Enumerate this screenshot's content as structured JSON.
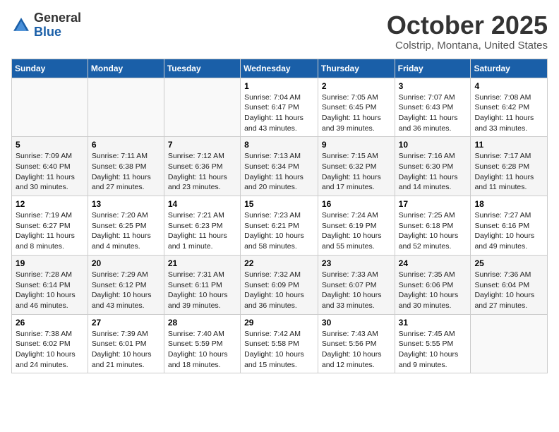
{
  "header": {
    "logo_general": "General",
    "logo_blue": "Blue",
    "title": "October 2025",
    "subtitle": "Colstrip, Montana, United States"
  },
  "weekdays": [
    "Sunday",
    "Monday",
    "Tuesday",
    "Wednesday",
    "Thursday",
    "Friday",
    "Saturday"
  ],
  "weeks": [
    [
      {
        "day": "",
        "info": ""
      },
      {
        "day": "",
        "info": ""
      },
      {
        "day": "",
        "info": ""
      },
      {
        "day": "1",
        "info": "Sunrise: 7:04 AM\nSunset: 6:47 PM\nDaylight: 11 hours\nand 43 minutes."
      },
      {
        "day": "2",
        "info": "Sunrise: 7:05 AM\nSunset: 6:45 PM\nDaylight: 11 hours\nand 39 minutes."
      },
      {
        "day": "3",
        "info": "Sunrise: 7:07 AM\nSunset: 6:43 PM\nDaylight: 11 hours\nand 36 minutes."
      },
      {
        "day": "4",
        "info": "Sunrise: 7:08 AM\nSunset: 6:42 PM\nDaylight: 11 hours\nand 33 minutes."
      }
    ],
    [
      {
        "day": "5",
        "info": "Sunrise: 7:09 AM\nSunset: 6:40 PM\nDaylight: 11 hours\nand 30 minutes."
      },
      {
        "day": "6",
        "info": "Sunrise: 7:11 AM\nSunset: 6:38 PM\nDaylight: 11 hours\nand 27 minutes."
      },
      {
        "day": "7",
        "info": "Sunrise: 7:12 AM\nSunset: 6:36 PM\nDaylight: 11 hours\nand 23 minutes."
      },
      {
        "day": "8",
        "info": "Sunrise: 7:13 AM\nSunset: 6:34 PM\nDaylight: 11 hours\nand 20 minutes."
      },
      {
        "day": "9",
        "info": "Sunrise: 7:15 AM\nSunset: 6:32 PM\nDaylight: 11 hours\nand 17 minutes."
      },
      {
        "day": "10",
        "info": "Sunrise: 7:16 AM\nSunset: 6:30 PM\nDaylight: 11 hours\nand 14 minutes."
      },
      {
        "day": "11",
        "info": "Sunrise: 7:17 AM\nSunset: 6:28 PM\nDaylight: 11 hours\nand 11 minutes."
      }
    ],
    [
      {
        "day": "12",
        "info": "Sunrise: 7:19 AM\nSunset: 6:27 PM\nDaylight: 11 hours\nand 8 minutes."
      },
      {
        "day": "13",
        "info": "Sunrise: 7:20 AM\nSunset: 6:25 PM\nDaylight: 11 hours\nand 4 minutes."
      },
      {
        "day": "14",
        "info": "Sunrise: 7:21 AM\nSunset: 6:23 PM\nDaylight: 11 hours\nand 1 minute."
      },
      {
        "day": "15",
        "info": "Sunrise: 7:23 AM\nSunset: 6:21 PM\nDaylight: 10 hours\nand 58 minutes."
      },
      {
        "day": "16",
        "info": "Sunrise: 7:24 AM\nSunset: 6:19 PM\nDaylight: 10 hours\nand 55 minutes."
      },
      {
        "day": "17",
        "info": "Sunrise: 7:25 AM\nSunset: 6:18 PM\nDaylight: 10 hours\nand 52 minutes."
      },
      {
        "day": "18",
        "info": "Sunrise: 7:27 AM\nSunset: 6:16 PM\nDaylight: 10 hours\nand 49 minutes."
      }
    ],
    [
      {
        "day": "19",
        "info": "Sunrise: 7:28 AM\nSunset: 6:14 PM\nDaylight: 10 hours\nand 46 minutes."
      },
      {
        "day": "20",
        "info": "Sunrise: 7:29 AM\nSunset: 6:12 PM\nDaylight: 10 hours\nand 43 minutes."
      },
      {
        "day": "21",
        "info": "Sunrise: 7:31 AM\nSunset: 6:11 PM\nDaylight: 10 hours\nand 39 minutes."
      },
      {
        "day": "22",
        "info": "Sunrise: 7:32 AM\nSunset: 6:09 PM\nDaylight: 10 hours\nand 36 minutes."
      },
      {
        "day": "23",
        "info": "Sunrise: 7:33 AM\nSunset: 6:07 PM\nDaylight: 10 hours\nand 33 minutes."
      },
      {
        "day": "24",
        "info": "Sunrise: 7:35 AM\nSunset: 6:06 PM\nDaylight: 10 hours\nand 30 minutes."
      },
      {
        "day": "25",
        "info": "Sunrise: 7:36 AM\nSunset: 6:04 PM\nDaylight: 10 hours\nand 27 minutes."
      }
    ],
    [
      {
        "day": "26",
        "info": "Sunrise: 7:38 AM\nSunset: 6:02 PM\nDaylight: 10 hours\nand 24 minutes."
      },
      {
        "day": "27",
        "info": "Sunrise: 7:39 AM\nSunset: 6:01 PM\nDaylight: 10 hours\nand 21 minutes."
      },
      {
        "day": "28",
        "info": "Sunrise: 7:40 AM\nSunset: 5:59 PM\nDaylight: 10 hours\nand 18 minutes."
      },
      {
        "day": "29",
        "info": "Sunrise: 7:42 AM\nSunset: 5:58 PM\nDaylight: 10 hours\nand 15 minutes."
      },
      {
        "day": "30",
        "info": "Sunrise: 7:43 AM\nSunset: 5:56 PM\nDaylight: 10 hours\nand 12 minutes."
      },
      {
        "day": "31",
        "info": "Sunrise: 7:45 AM\nSunset: 5:55 PM\nDaylight: 10 hours\nand 9 minutes."
      },
      {
        "day": "",
        "info": ""
      }
    ]
  ]
}
